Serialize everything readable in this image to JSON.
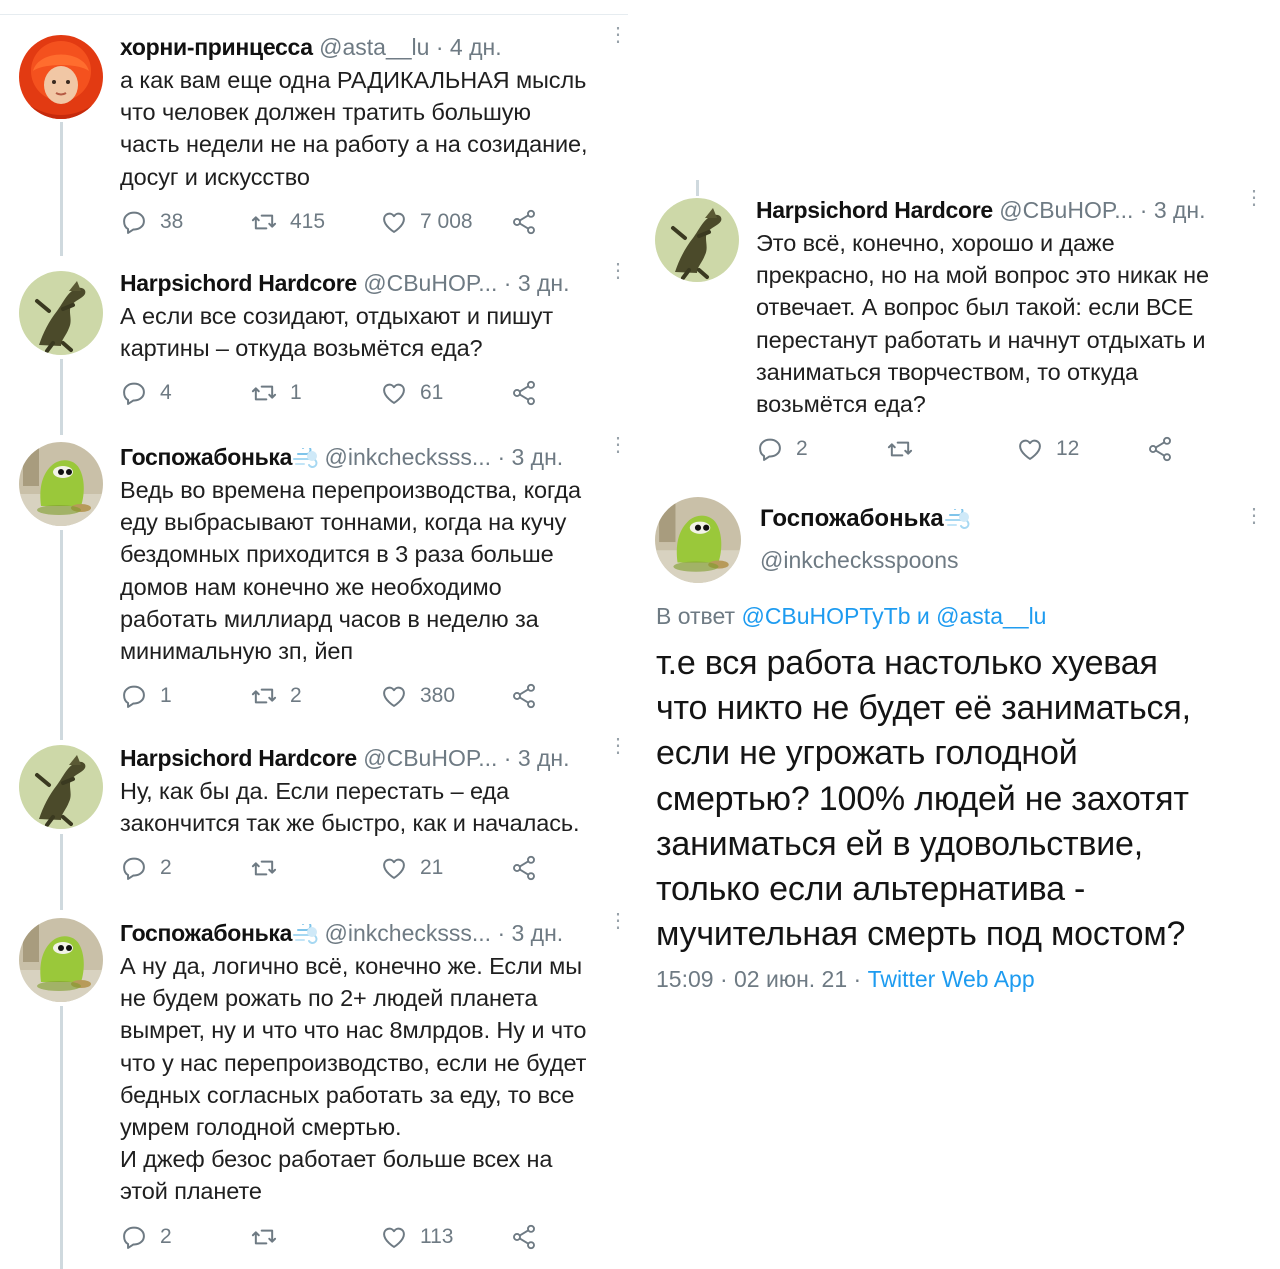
{
  "left_thread": [
    {
      "name": "хорни-принцесса",
      "handle": "@asta__lu",
      "time": "· 4 дн.",
      "text": "а как вам еще одна РАДИКАЛЬНАЯ мысль\nчто человек должен тратить большую\nчасть недели не на работу а на созидание,\nдосуг и искусство",
      "replies": "38",
      "retweets": "415",
      "likes": "7 008",
      "avatar": "redhat-girl-avatar"
    },
    {
      "name": "Harpsichord Hardcore",
      "handle": "@СВuHOP...",
      "time": "· 3 дн.",
      "text": "А если все созидают, отдыхают и пишут\nкартины – откуда возьмётся еда?",
      "replies": "4",
      "retweets": "1",
      "likes": "61",
      "avatar": "dancing-creature-avatar"
    },
    {
      "name": "Госпожабонька",
      "handle": "@inkchecksss...",
      "time": "· 3 дн.",
      "text": "Ведь во времена перепроизводства, когда\nеду выбрасывают тоннами, когда на кучу\nбездомных приходится в 3 раза больше\nдомов нам конечно же необходимо\nработать миллиард часов в неделю за\nминимальную зп, йеп",
      "replies": "1",
      "retweets": "2",
      "likes": "380",
      "avatar": "green-frog-avatar"
    },
    {
      "name": "Harpsichord Hardcore",
      "handle": "@СВuHOP...",
      "time": "· 3 дн.",
      "text": "Ну, как бы да. Если перестать – еда\nзакончится так же быстро, как и началась.",
      "replies": "2",
      "retweets": "",
      "likes": "21",
      "avatar": "dancing-creature-avatar"
    },
    {
      "name": "Госпожабонька",
      "handle": "@inkchecksss...",
      "time": "· 3 дн.",
      "text": "А ну да, логично всё, конечно же. Если мы\nне будем рожать по 2+ людей планета\nвымрет, ну и что что нас 8млрдов. Ну и что\nчто у нас перепроизводство, если не будет\nбедных согласных работать за еду, то все\nумрем голодной смертью.\nИ джеф безос работает больше всех на\nэтой планете",
      "replies": "2",
      "retweets": "",
      "likes": "113",
      "avatar": "green-frog-avatar"
    }
  ],
  "right_reply": {
    "name": "Harpsichord Hardcore",
    "handle": "@СВuHOP...",
    "time": "· 3 дн.",
    "text": "Это всё, конечно, хорошо и даже\nпрекрасно, но на мой вопрос это никак не\nотвечает. А вопрос был такой: если ВСЕ\nперестанут работать и начнут отдыхать и\nзаниматься творчеством, то откуда\nвозьмётся еда?",
    "replies": "2",
    "retweets": "",
    "likes": "12"
  },
  "main_tweet": {
    "name": "Госпожабонька",
    "handle": "@inkchecksspoons",
    "reply_prefix": "В ответ",
    "reply_user1": "@СВuHOPTyTb",
    "reply_and": "и",
    "reply_user2": "@asta__lu",
    "text": "т.е вся работа настолько хуевая\nчто никто не будет её заниматься,\nесли не угрожать голодной\nсмертью? 100% людей не захотят\nзаниматься ей в удовольствие,\nтолько если альтернатива -\nмучительная смерть под мостом?",
    "timestamp": "15:09 · 02 июн. 21 ·",
    "client": "Twitter Web App"
  },
  "colors": {
    "link": "#1d9bf0",
    "muted": "#6e7a83",
    "thread_line": "#cfd9de"
  }
}
